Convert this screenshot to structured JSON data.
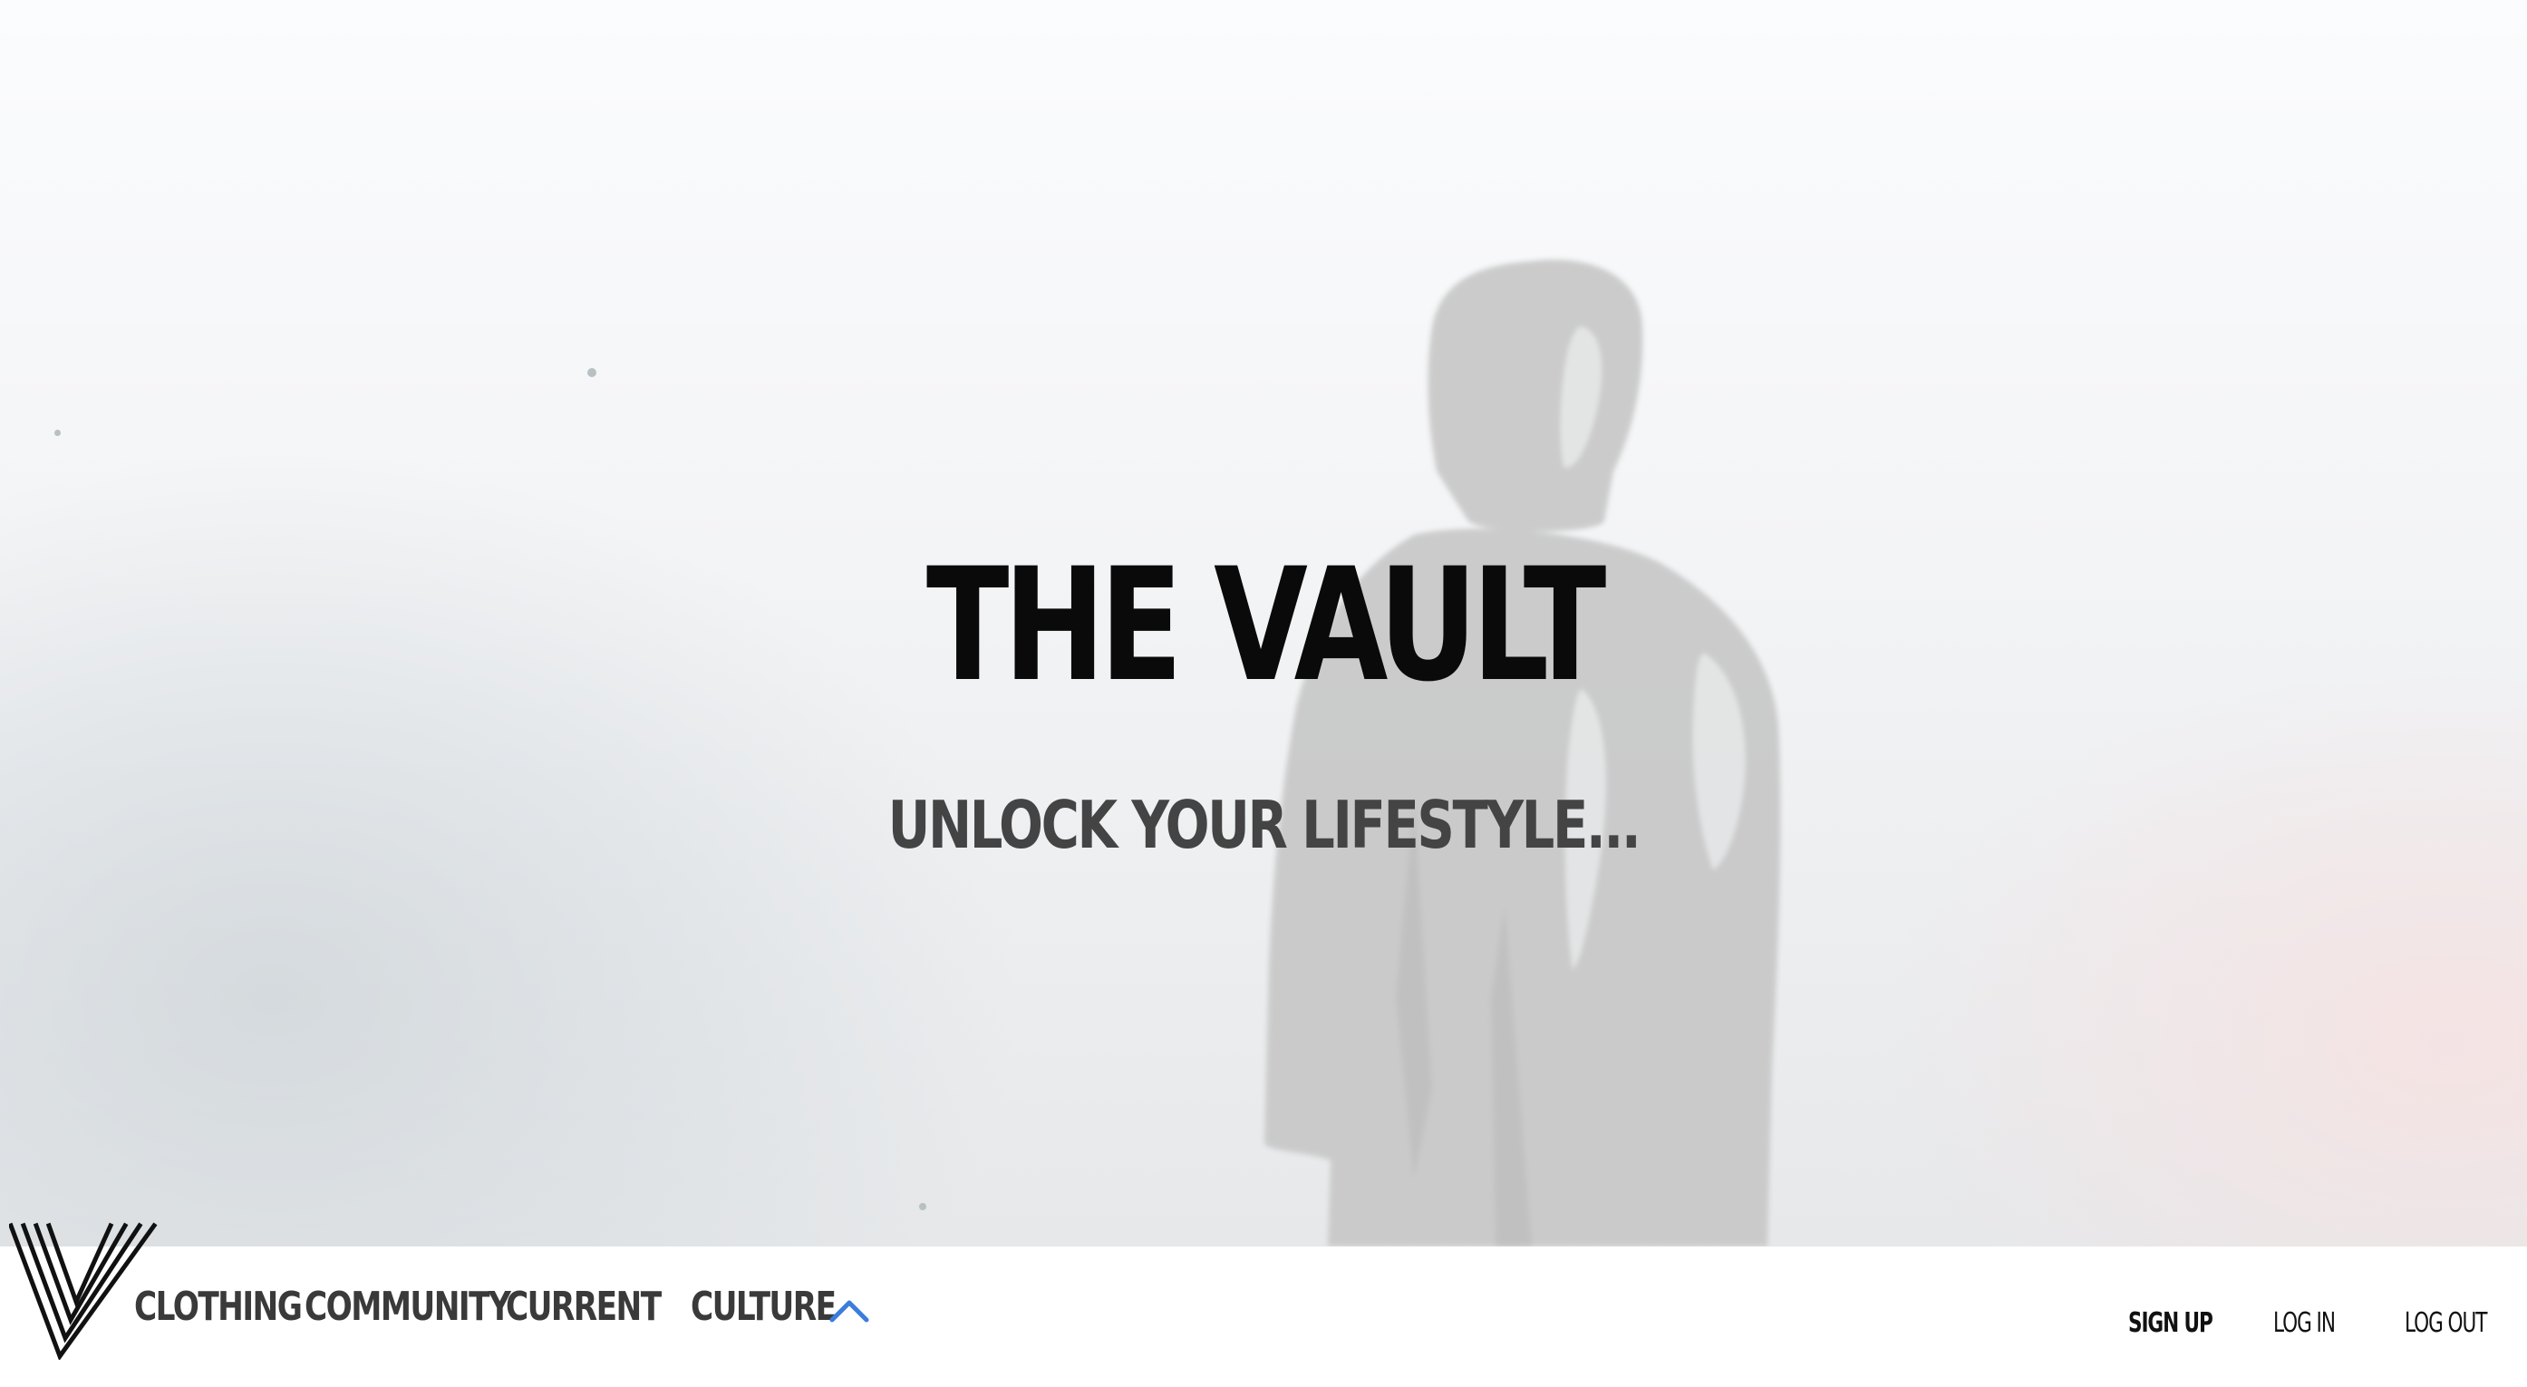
{
  "hero": {
    "title": "THE VAULT",
    "subtitle": "UNLOCK YOUR LIFESTYLE..."
  },
  "nav": {
    "items": [
      {
        "label": "CLOTHING"
      },
      {
        "label": "COMMUNITY"
      },
      {
        "label": "CURRENT"
      },
      {
        "label": "CULTURE"
      }
    ],
    "chevron_icon": "chevron-up-icon",
    "logo_icon": "vault-v-logo-icon"
  },
  "auth": {
    "sign_up": "SIGN UP",
    "log_in": "LOG IN",
    "log_out": "LOG OUT"
  },
  "colors": {
    "accent": "#3b7ddd",
    "text_dark": "#0a0a0a",
    "text_muted": "#444444"
  }
}
